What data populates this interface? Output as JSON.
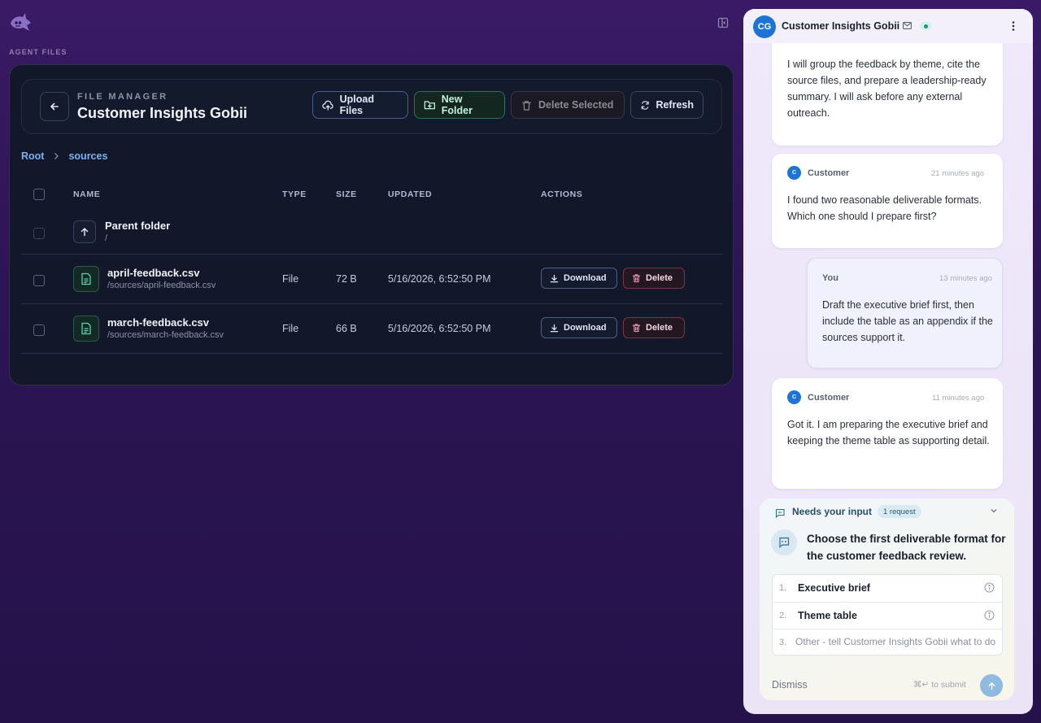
{
  "sidebar": {
    "section_label": "AGENT FILES"
  },
  "file_manager": {
    "eyebrow": "FILE MANAGER",
    "title": "Customer Insights Gobii",
    "buttons": {
      "upload": "Upload Files",
      "new_folder": "New Folder",
      "delete_selected": "Delete Selected",
      "refresh": "Refresh"
    },
    "breadcrumb": [
      "Root",
      "sources"
    ],
    "columns": [
      "NAME",
      "TYPE",
      "SIZE",
      "UPDATED",
      "ACTIONS"
    ],
    "parent": {
      "name": "Parent folder",
      "path": "/"
    },
    "rows": [
      {
        "name": "april-feedback.csv",
        "path": "/sources/april-feedback.csv",
        "type": "File",
        "size": "72 B",
        "updated": "5/16/2026, 6:52:50 PM",
        "download_label": "Download",
        "delete_label": "Delete"
      },
      {
        "name": "march-feedback.csv",
        "path": "/sources/march-feedback.csv",
        "type": "File",
        "size": "66 B",
        "updated": "5/16/2026, 6:52:50 PM",
        "download_label": "Download",
        "delete_label": "Delete"
      }
    ]
  },
  "chat": {
    "avatar_initials": "CG",
    "title": "Customer Insights Gobii",
    "messages": [
      {
        "author": "",
        "time": "",
        "text": "I will group the feedback by theme, cite the source files, and prepare a leadership-ready summary. I will ask before any external outreach."
      },
      {
        "author": "Customer",
        "avatar": "C",
        "time": "21 minutes ago",
        "text": "I found two reasonable deliverable formats. Which one should I prepare first?"
      },
      {
        "author": "You",
        "time": "13 minutes ago",
        "text": "Draft the executive brief first, then include the table as an appendix if the sources support it."
      },
      {
        "author": "Customer",
        "avatar": "C",
        "time": "11 minutes ago",
        "text": "Got it. I am preparing the executive brief and keeping the theme table as supporting detail."
      }
    ],
    "needs_input": {
      "label": "Needs your input",
      "badge": "1 request",
      "question": "Choose the first deliverable format for the customer feedback review.",
      "options": [
        {
          "num": "1.",
          "label": "Executive brief"
        },
        {
          "num": "2.",
          "label": "Theme table"
        }
      ],
      "other_num": "3.",
      "other_placeholder": "Other - tell Customer Insights Gobii what to do",
      "dismiss": "Dismiss",
      "submit_hint": "⌘↵ to submit"
    }
  },
  "colors": {
    "accent_blue": "#1e73d6",
    "link": "#7eb0f0",
    "delete_border": "#7a3448",
    "new_folder_border": "#2f6f5c"
  }
}
